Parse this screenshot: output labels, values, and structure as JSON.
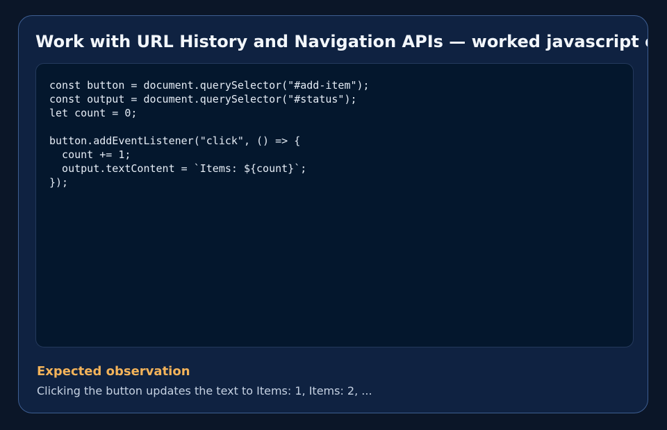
{
  "card": {
    "title": "Work with URL History and Navigation APIs — worked javascript example"
  },
  "code_panel": {
    "language": "javascript",
    "code": "const button = document.querySelector(\"#add-item\");\nconst output = document.querySelector(\"#status\");\nlet count = 0;\n\nbutton.addEventListener(\"click\", () => {\n  count += 1;\n  output.textContent = `Items: ${count}`;\n});"
  },
  "observation": {
    "heading": "Expected observation",
    "text": "Clicking the button updates the text to Items: 1, Items: 2, ..."
  },
  "colors": {
    "page_background": "#0b1628",
    "card_background": "#0f2241",
    "card_border": "#3e5f92",
    "code_background": "#04172d",
    "heading_accent": "#f3b35a"
  }
}
